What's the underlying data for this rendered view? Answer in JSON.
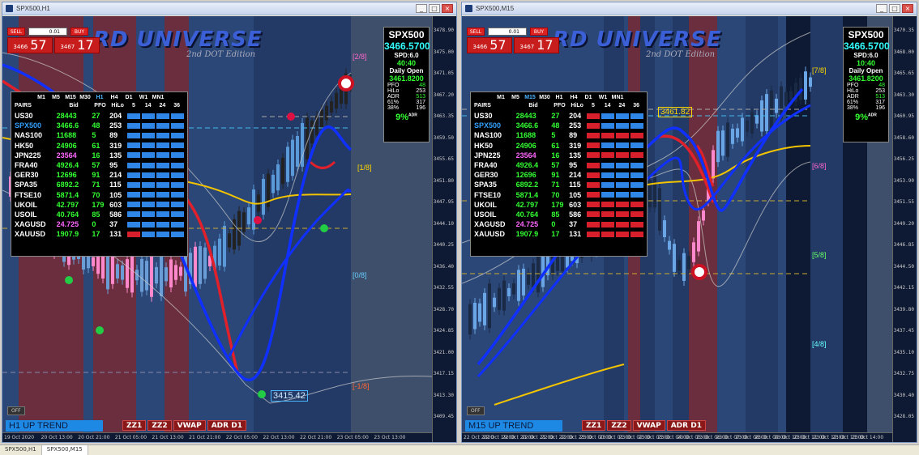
{
  "tabs": [
    "SPX500,H1",
    "SPX500,M15"
  ],
  "windows": [
    {
      "title": "SPX500,H1",
      "brand": {
        "logo": "RD UNIVERSE",
        "edition": "2nd DOT Edition"
      },
      "trade": {
        "sell": "SELL",
        "buy": "BUY",
        "lot": "0.01",
        "bid_small": "3466",
        "bid_big": "57",
        "ask_small": "3467",
        "ask_big": "17"
      },
      "info": {
        "symbol": "SPX500",
        "price": "3466.5700",
        "spread": "SPD:6.0",
        "timer": "40:40",
        "daily_open_label": "Daily Open",
        "daily_open": "3461.8200",
        "pfo_l": "PFO",
        "pfo": "48",
        "hilo_l": "HiLo",
        "hilo": "253",
        "adr_l": "ADR",
        "adr": "513",
        "p61_l": "61%",
        "p61": "317",
        "p38_l": "38%",
        "p38": "196",
        "pct": "9%",
        "pct_sup": "ADR"
      },
      "timeframes": [
        "M1",
        "M5",
        "M15",
        "M30",
        "H1",
        "H4",
        "D1",
        "W1",
        "MN1"
      ],
      "active_tf": "H1",
      "trend": "H1   UP TREND",
      "off": "OFF",
      "buttons": [
        "ZZ1",
        "ZZ2",
        "VWAP",
        "ADR D1"
      ],
      "price_label": "3415.42",
      "levels": [
        "[2/8]",
        "[1/8]",
        "[0/8]",
        "[-1/8]"
      ],
      "yticks": [
        "3478.90",
        "3475.00",
        "3471.05",
        "3467.20",
        "3463.35",
        "3459.50",
        "3455.65",
        "3451.80",
        "3447.95",
        "3444.10",
        "3440.25",
        "3436.40",
        "3432.55",
        "3428.70",
        "3424.85",
        "3421.00",
        "3417.15",
        "3413.30",
        "3409.45"
      ],
      "xticks": [
        "19 Oct 2020",
        "20 Oct 13:00",
        "20 Oct 21:00",
        "21 Oct 05:00",
        "21 Oct 13:00",
        "21 Oct 21:00",
        "22 Oct 05:00",
        "22 Oct 13:00",
        "22 Oct 21:00",
        "23 Oct 05:00",
        "23 Oct 13:00"
      ]
    },
    {
      "title": "SPX500,M15",
      "brand": {
        "logo": "RD UNIVERSE",
        "edition": "2nd DOT Edition"
      },
      "trade": {
        "sell": "SELL",
        "buy": "BUY",
        "lot": "0.01",
        "bid_small": "3466",
        "bid_big": "57",
        "ask_small": "3467",
        "ask_big": "17"
      },
      "info": {
        "symbol": "SPX500",
        "price": "3466.5700",
        "spread": "SPD:6.0",
        "timer": "10:40",
        "daily_open_label": "Daily Open",
        "daily_open": "3461.8200",
        "pfo_l": "PFO",
        "pfo": "48",
        "hilo_l": "HiLo",
        "hilo": "253",
        "adr_l": "ADR",
        "adr": "513",
        "p61_l": "61%",
        "p61": "317",
        "p38_l": "38%",
        "p38": "196",
        "pct": "9%",
        "pct_sup": "ADR"
      },
      "timeframes": [
        "M1",
        "M5",
        "M15",
        "M30",
        "H1",
        "H4",
        "D1",
        "W1",
        "MN1"
      ],
      "active_tf": "M15",
      "trend": "M15   UP TREND",
      "off": "OFF",
      "buttons": [
        "ZZ1",
        "ZZ2",
        "VWAP",
        "ADR D1"
      ],
      "price_label": "3461.82",
      "levels": [
        "[7/8]",
        "[6/8]",
        "[5/8]",
        "[4/8]"
      ],
      "yticks": [
        "3470.35",
        "3468.00",
        "3465.65",
        "3463.30",
        "3460.95",
        "3458.60",
        "3456.25",
        "3453.90",
        "3451.55",
        "3449.20",
        "3446.85",
        "3444.50",
        "3442.15",
        "3439.80",
        "3437.45",
        "3435.10",
        "3432.75",
        "3430.40",
        "3428.05"
      ],
      "xticks": [
        "22 Oct 2020",
        "22 Oct 19:00",
        "22 Oct 20:00",
        "22 Oct 21:00",
        "22 Oct 22:00",
        "22 Oct 23:00",
        "23 Oct 00:00",
        "23 Oct 01:00",
        "23 Oct 02:00",
        "23 Oct 03:00",
        "23 Oct 04:00",
        "23 Oct 05:00",
        "23 Oct 06:00",
        "23 Oct 07:00",
        "23 Oct 08:00",
        "23 Oct 09:00",
        "23 Oct 10:00",
        "23 Oct 11:00",
        "23 Oct 12:00",
        "23 Oct 13:00",
        "23 Oct 14:00"
      ]
    }
  ],
  "table": {
    "headers": [
      "PAIRS",
      "Bid",
      "PFO",
      "HiLo",
      "5",
      "14",
      "24",
      "36"
    ],
    "rows": [
      {
        "pair": "US30",
        "bid": "28443",
        "pfo": "27",
        "hilo": "204",
        "color": "#ffffff",
        "bidcolor": "#33ff33"
      },
      {
        "pair": "SPX500",
        "bid": "3466.6",
        "pfo": "48",
        "hilo": "253",
        "color": "#33a0ff",
        "bidcolor": "#33ff33"
      },
      {
        "pair": "NAS100",
        "bid": "11688",
        "pfo": "5",
        "hilo": "89",
        "color": "#ffffff",
        "bidcolor": "#33ff33"
      },
      {
        "pair": "HK50",
        "bid": "24906",
        "pfo": "61",
        "hilo": "319",
        "color": "#ffffff",
        "bidcolor": "#33ff33"
      },
      {
        "pair": "JPN225",
        "bid": "23564",
        "pfo": "16",
        "hilo": "135",
        "color": "#ffffff",
        "bidcolor": "#ff66ff"
      },
      {
        "pair": "FRA40",
        "bid": "4926.4",
        "pfo": "57",
        "hilo": "95",
        "color": "#ffffff",
        "bidcolor": "#33ff33"
      },
      {
        "pair": "GER30",
        "bid": "12696",
        "pfo": "91",
        "hilo": "214",
        "color": "#ffffff",
        "bidcolor": "#33ff33"
      },
      {
        "pair": "SPA35",
        "bid": "6892.2",
        "pfo": "71",
        "hilo": "115",
        "color": "#ffffff",
        "bidcolor": "#33ff33"
      },
      {
        "pair": "FTSE10",
        "bid": "5871.4",
        "pfo": "70",
        "hilo": "105",
        "color": "#ffffff",
        "bidcolor": "#33ff33"
      },
      {
        "pair": "UKOIL",
        "bid": "42.797",
        "pfo": "179",
        "hilo": "603",
        "color": "#ffffff",
        "bidcolor": "#33ff33"
      },
      {
        "pair": "USOIL",
        "bid": "40.764",
        "pfo": "85",
        "hilo": "586",
        "color": "#ffffff",
        "bidcolor": "#33ff33"
      },
      {
        "pair": "XAGUSD",
        "bid": "24.725",
        "pfo": "0",
        "hilo": "37",
        "color": "#ffffff",
        "bidcolor": "#ff66ff"
      },
      {
        "pair": "XAUUSD",
        "bid": "1907.9",
        "pfo": "17",
        "hilo": "131",
        "color": "#ffffff",
        "bidcolor": "#33ff33"
      }
    ],
    "bars_h1": [
      [
        "b",
        "b",
        "b",
        "b"
      ],
      [
        "b",
        "b",
        "b",
        "b"
      ],
      [
        "b",
        "b",
        "b",
        "b"
      ],
      [
        "b",
        "b",
        "b",
        "b"
      ],
      [
        "b",
        "b",
        "b",
        "b"
      ],
      [
        "b",
        "b",
        "b",
        "b"
      ],
      [
        "b",
        "b",
        "b",
        "b"
      ],
      [
        "b",
        "b",
        "b",
        "b"
      ],
      [
        "b",
        "b",
        "b",
        "b"
      ],
      [
        "b",
        "b",
        "b",
        "b"
      ],
      [
        "b",
        "b",
        "b",
        "b"
      ],
      [
        "b",
        "b",
        "b",
        "b"
      ],
      [
        "r",
        "b",
        "b",
        "b"
      ]
    ],
    "bars_m15": [
      [
        "r",
        "b",
        "b",
        "b"
      ],
      [
        "r",
        "b",
        "b",
        "b"
      ],
      [
        "r",
        "r",
        "r",
        "r"
      ],
      [
        "r",
        "b",
        "b",
        "b"
      ],
      [
        "r",
        "r",
        "r",
        "r"
      ],
      [
        "r",
        "b",
        "b",
        "b"
      ],
      [
        "r",
        "b",
        "b",
        "b"
      ],
      [
        "r",
        "b",
        "b",
        "b"
      ],
      [
        "r",
        "b",
        "b",
        "b"
      ],
      [
        "r",
        "r",
        "r",
        "r"
      ],
      [
        "r",
        "r",
        "r",
        "r"
      ],
      [
        "r",
        "r",
        "r",
        "r"
      ],
      [
        "r",
        "r",
        "r",
        "r"
      ]
    ]
  },
  "colors": {
    "bar_blue": "#2f86e6",
    "bar_red": "#d8202c",
    "accent": "#3b5fd6"
  }
}
